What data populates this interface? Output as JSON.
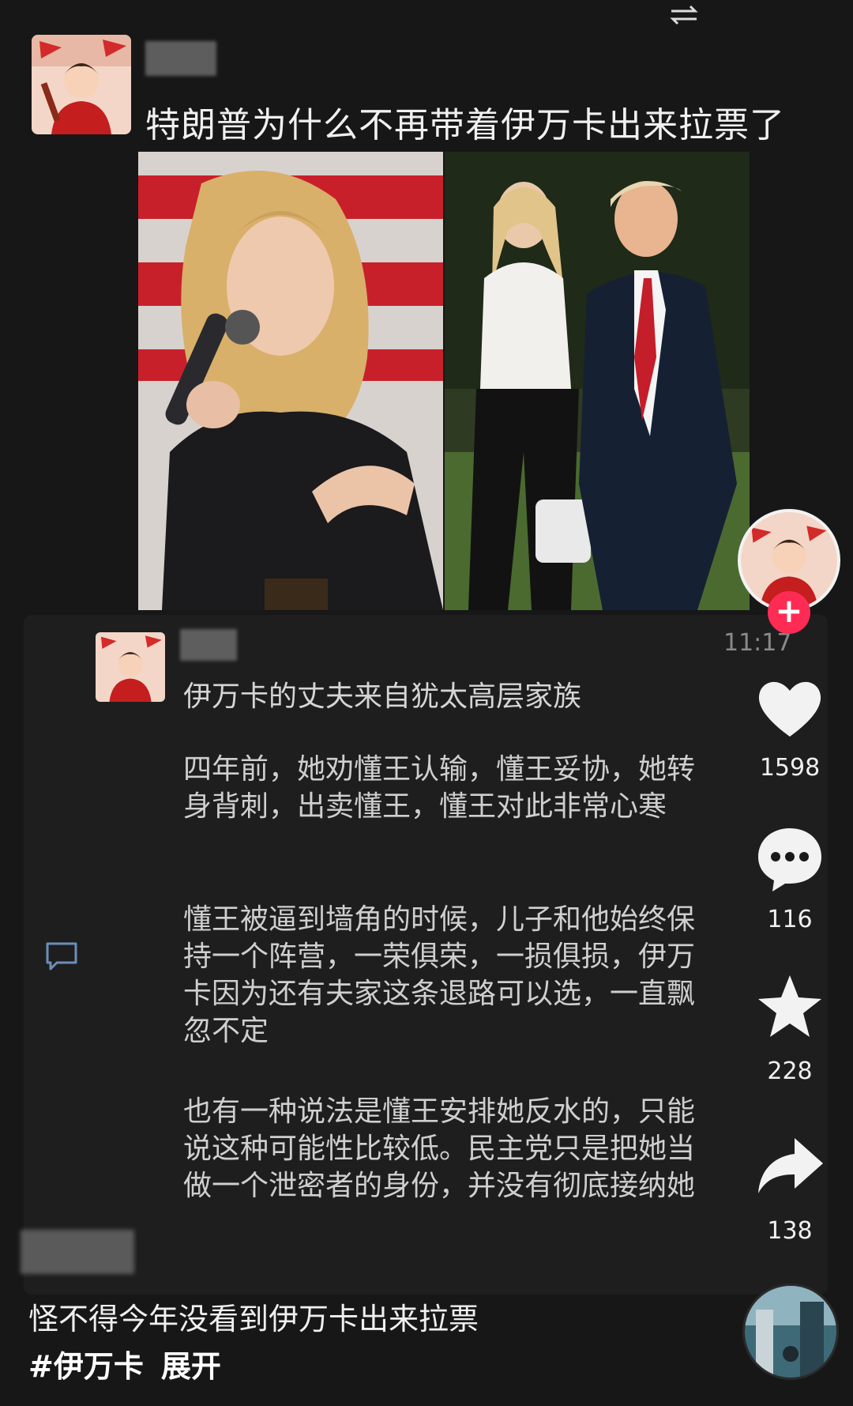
{
  "post": {
    "title": "特朗普为什么不再带着伊万卡出来拉票了"
  },
  "comment": {
    "time": "11:17",
    "heading": "伊万卡的丈夫来自犹太高层家族",
    "paragraphs": [
      "四年前，她劝懂王认输，懂王妥协，她转身背刺，出卖懂王，懂王对此非常心寒",
      "懂王被逼到墙角的时候，儿子和他始终保持一个阵营，一荣俱荣，一损俱损，伊万卡因为还有夫家这条退路可以选，一直飘忽不定",
      "也有一种说法是懂王安排她反水的，只能说这种可能性比较低。民主党只是把她当做一个泄密者的身份，并没有彻底接纳她"
    ]
  },
  "actions": {
    "follow": "+",
    "likes": "1598",
    "comments": "116",
    "favorites": "228",
    "shares": "138"
  },
  "caption": {
    "line1": "怪不得今年没看到伊万卡出来拉票",
    "hashtag": "#伊万卡",
    "expand": "展开"
  },
  "icons": [
    "switch-icon",
    "heart-icon",
    "comment-bubble-icon",
    "star-icon",
    "share-arrow-icon",
    "reply-icon",
    "music-disc"
  ],
  "colors": {
    "accent": "#fe2c55",
    "background": "#171717"
  }
}
